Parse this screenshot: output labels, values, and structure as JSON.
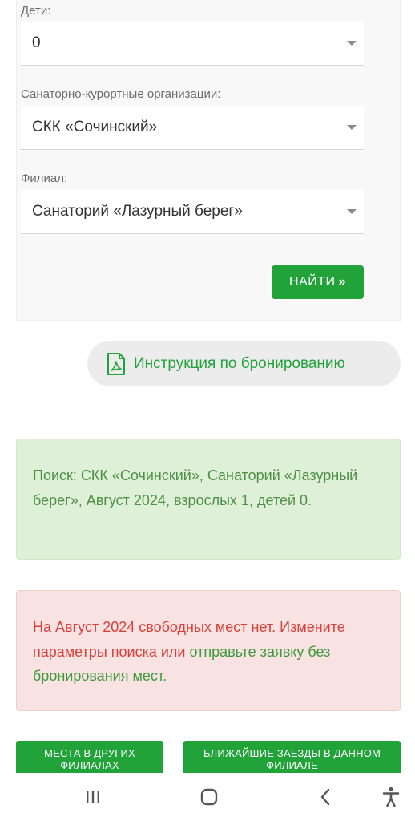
{
  "form": {
    "children_label": "Дети:",
    "children_value": "0",
    "org_label": "Санаторно-курортные организации:",
    "org_value": "СКК «Сочинский»",
    "branch_label": "Филиал:",
    "branch_value": "Санаторий «Лазурный берег»",
    "find_button": "НАЙТИ",
    "find_arrows": "»"
  },
  "instruction": {
    "label": "Инструкция по бронированию",
    "icon": "pdf-icon"
  },
  "search_info": {
    "text": "Поиск: СКК «Сочинский», Санаторий «Лазурный берег», Август 2024, взрослых 1, детей 0."
  },
  "no_places": {
    "text_red": "На Август 2024 свободных мест нет. Измените параметры поиска или ",
    "link_text": "отправьте заявку без бронирования мест."
  },
  "buttons": {
    "other_branches": "МЕСТА В ДРУГИХ ФИЛИАЛАХ",
    "nearest_checkins": "БЛИЖАЙШИЕ ЗАЕЗДЫ В ДАННОМ ФИЛИАЛЕ"
  },
  "navbar": {
    "icons": [
      "recent-apps-icon",
      "home-icon",
      "back-icon",
      "accessibility-icon"
    ]
  },
  "colors": {
    "accent": "#21a33a",
    "success_bg": "#dff0d8",
    "danger_bg": "#f9e2e2",
    "danger_text": "#d9403b"
  }
}
